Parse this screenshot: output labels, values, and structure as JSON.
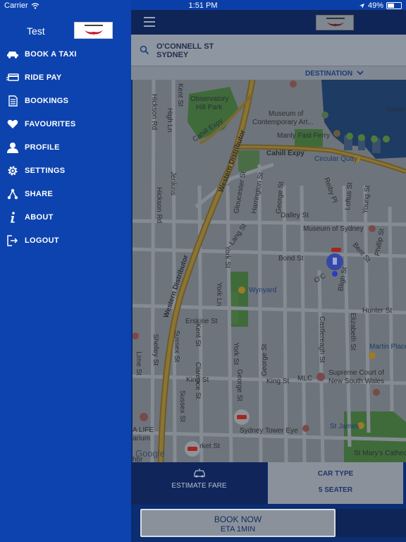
{
  "status_bar": {
    "carrier": "Carrier",
    "time": "1:51 PM",
    "battery": "49%"
  },
  "sidebar": {
    "user_name": "Test",
    "items": [
      {
        "label": "BOOK A TAXI",
        "icon": "taxi-icon"
      },
      {
        "label": "RIDE PAY",
        "icon": "card-icon"
      },
      {
        "label": "BOOKINGS",
        "icon": "document-icon"
      },
      {
        "label": "FAVOURITES",
        "icon": "heart-icon"
      },
      {
        "label": "PROFILE",
        "icon": "person-icon"
      },
      {
        "label": "SETTINGS",
        "icon": "gear-icon"
      },
      {
        "label": "SHARE",
        "icon": "share-icon"
      },
      {
        "label": "ABOUT",
        "icon": "info-icon"
      },
      {
        "label": "LOGOUT",
        "icon": "logout-icon"
      }
    ]
  },
  "main": {
    "search": {
      "line1": "O'CONNELL ST",
      "line2": "SYDNEY"
    },
    "destination_label": "DESTINATION",
    "map": {
      "labels": {
        "observatory": "Observatory",
        "hill_park": "Hill Park",
        "cahill_expy_1": "Cahill Expy",
        "cahill_expy_2": "Cahill Expy",
        "museum_contemp_1": "Museum of",
        "museum_contemp_2": "Contemporary Art...",
        "manly_ferry": "Manly Fast Ferry",
        "circular_quay": "Circular Quay",
        "gov": "Gover",
        "western_dist_1": "Western Distributor",
        "western_dist_2": "Western Distributor",
        "kent_st_1": "Kent St",
        "kent_st_2": "Kent St",
        "hickson_rd_1": "Hickson Rd",
        "hickson_rd_2": "Hickson Rd",
        "high_ln": "High Ln",
        "jenkins": "Jenkins",
        "gloucester": "Gloucester St",
        "harrington": "Harrington St",
        "george_st_1": "George St",
        "george_st_2": "George St",
        "george_st_3": "George St",
        "reiby": "Reiby Pl",
        "loftus": "Loftus St",
        "young": "Young St",
        "dalley": "Dalley St",
        "museum_sydney": "Museum of Sydney",
        "lang": "Lang St",
        "york_st_1": "York St",
        "york_st_2": "York St",
        "york_ln": "York Ln",
        "bond": "Bond St",
        "bent": "Bent St",
        "phillip": "Phillip St",
        "ocon": "O'C",
        "bligh": "Bligh St",
        "wynyard": "Wynyard",
        "hunter": "Hunter St",
        "erskine": "Erskine St",
        "castlereagh": "Castlereagh St",
        "elizabeth": "Elizabeth St",
        "martin_place": "Martin Place",
        "sussex_1": "Sussex St",
        "sussex_2": "Sussex St",
        "clarence": "Clarence St",
        "lime": "Lime St",
        "shelley": "Shelley St",
        "king_1": "King St",
        "king_2": "King St",
        "mlc": "MLC",
        "supreme_1": "Supreme Court of",
        "supreme_2": "New South Wales",
        "sydney_tower": "Sydney Tower Eye",
        "st_james": "St James",
        "market": "rket St",
        "a_life": "A LIFE",
        "arium": "arium",
        "st_marys": "St Mary's Cathedr",
        "google": "Google",
        "hbr": "hbr"
      }
    },
    "estimate_fare_label": "ESTIMATE FARE",
    "car_type_label": "CAR TYPE",
    "car_type_value": "5 SEATER",
    "book_now_label": "BOOK NOW",
    "eta_label": "ETA 1MIN"
  }
}
